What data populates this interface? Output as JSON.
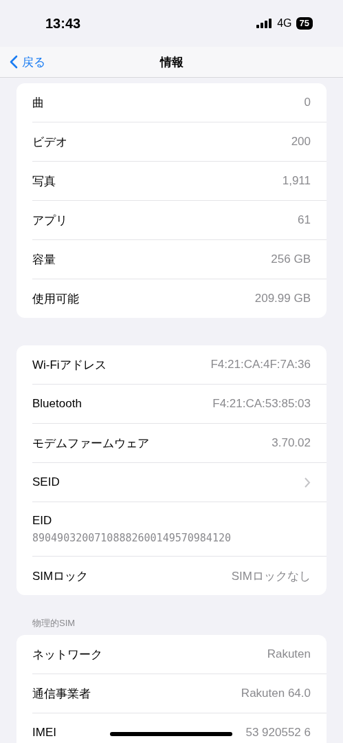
{
  "status_bar": {
    "time": "13:43",
    "network": "4G",
    "battery": "75"
  },
  "nav": {
    "back": "戻る",
    "title": "情報"
  },
  "sections": [
    {
      "rows": [
        {
          "kind": "value",
          "label": "曲",
          "value": "0"
        },
        {
          "kind": "value",
          "label": "ビデオ",
          "value": "200"
        },
        {
          "kind": "value",
          "label": "写真",
          "value": "1,911"
        },
        {
          "kind": "value",
          "label": "アプリ",
          "value": "61"
        },
        {
          "kind": "value",
          "label": "容量",
          "value": "256 GB"
        },
        {
          "kind": "value",
          "label": "使用可能",
          "value": "209.99 GB"
        }
      ]
    },
    {
      "rows": [
        {
          "kind": "value",
          "label": "Wi-Fiアドレス",
          "value": "F4:21:CA:4F:7A:36"
        },
        {
          "kind": "value",
          "label": "Bluetooth",
          "value": "F4:21:CA:53:85:03"
        },
        {
          "kind": "value",
          "label": "モデムファームウェア",
          "value": "3.70.02"
        },
        {
          "kind": "chevron",
          "label": "SEID"
        },
        {
          "kind": "stacked",
          "label": "EID",
          "value": "89049032007108882600149570984120"
        },
        {
          "kind": "value",
          "label": "SIMロック",
          "value": "SIMロックなし"
        }
      ]
    },
    {
      "header": "物理的SIM",
      "rows": [
        {
          "kind": "value",
          "label": "ネットワーク",
          "value": "Rakuten"
        },
        {
          "kind": "value",
          "label": "通信事業者",
          "value": "Rakuten 64.0"
        },
        {
          "kind": "value",
          "label": "IMEI",
          "value": "53 920552 6"
        }
      ]
    }
  ]
}
